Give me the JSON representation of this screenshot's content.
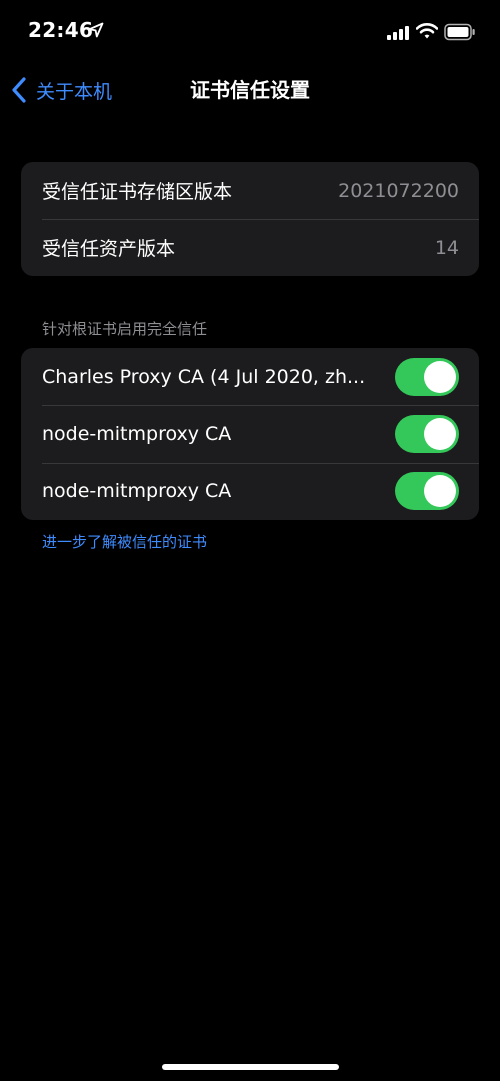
{
  "status_bar": {
    "time": "22:46",
    "icons": [
      "location-arrow-icon",
      "cellular-signal-icon",
      "wifi-icon",
      "battery-icon"
    ]
  },
  "nav": {
    "back_label": "关于本机",
    "title": "证书信任设置"
  },
  "info_group": {
    "rows": [
      {
        "label": "受信任证书存储区版本",
        "value": "2021072200"
      },
      {
        "label": "受信任资产版本",
        "value": "14"
      }
    ]
  },
  "trust_section": {
    "header": "针对根证书启用完全信任",
    "certificates": [
      {
        "name": "Charles Proxy CA (4 Jul 2020, zh...",
        "enabled": true
      },
      {
        "name": "node-mitmproxy CA",
        "enabled": true
      },
      {
        "name": "node-mitmproxy CA",
        "enabled": true
      }
    ]
  },
  "footer_link": "进一步了解被信任的证书",
  "colors": {
    "accent": "#3f8cff",
    "toggle_on": "#34c759",
    "group_bg": "#1c1c1e",
    "secondary_text": "#8e8e93"
  }
}
